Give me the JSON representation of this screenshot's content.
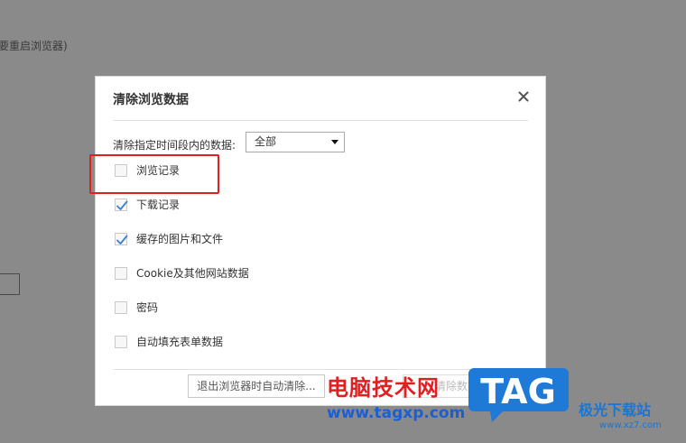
{
  "background": {
    "text": "要重启浏览器)"
  },
  "dialog": {
    "title": "清除浏览数据",
    "range_label": "清除指定时间段内的数据:",
    "range_selected": "全部",
    "items": [
      {
        "label": "浏览记录",
        "checked": false
      },
      {
        "label": "下载记录",
        "checked": true
      },
      {
        "label": "缓存的图片和文件",
        "checked": true
      },
      {
        "label": "Cookie及其他网站数据",
        "checked": false
      },
      {
        "label": "密码",
        "checked": false
      },
      {
        "label": "自动填充表单数据",
        "checked": false
      }
    ],
    "footer_button": "退出浏览器时自动清除...",
    "footer_button_2": "清除数据"
  },
  "watermark": {
    "main_text": "电脑技术网",
    "url": "www.tagxp.com",
    "logo_text": "TAG",
    "site_name": "极光下载站",
    "site_url": "www.xz7.com"
  },
  "colors": {
    "overlay": "#8a8a8a",
    "highlight": "#e02020",
    "check": "#3b7ed8",
    "watermark_blue": "#1976d2"
  }
}
